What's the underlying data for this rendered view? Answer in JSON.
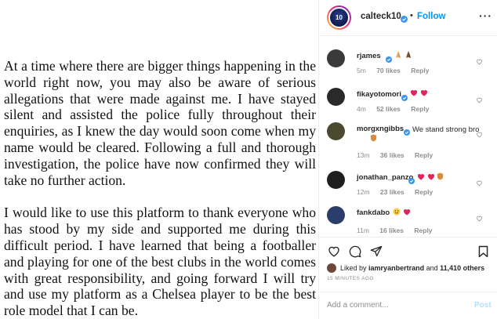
{
  "post": {
    "paragraphs": [
      "At a time where there are bigger things happening in the world right now, you may also be aware of serious allegations that were made against me. I have stayed silent and assisted the police fully throughout their enquiries, as I knew the day would soon come when my name would be cleared. Following a full and thorough investigation, the police have now confirmed they will take no further action.",
      "I would like to use this platform to thank everyone who has stood by my side and supported me during this difficult period. I have learned that being a footballer and playing for one of the best clubs in the world comes with great responsibility, and going forward I will try and use my platform as a Chelsea player to be the best role model that I can be."
    ]
  },
  "header": {
    "username": "calteck10",
    "separator": "•",
    "follow_label": "Follow",
    "more_label": "···",
    "avatar_text": "10"
  },
  "comments": [
    {
      "username": "rjames",
      "verified": true,
      "text": "",
      "emojis": [
        "folded-hands",
        "folded-hands"
      ],
      "age": "5m",
      "likes": "70 likes",
      "reply": "Reply",
      "avatar_color": "#3a3a3a"
    },
    {
      "username": "fikayotomori",
      "verified": true,
      "text": "",
      "emojis": [
        "red-heart",
        "red-heart"
      ],
      "age": "4m",
      "likes": "52 likes",
      "reply": "Reply",
      "avatar_color": "#2a2a2a"
    },
    {
      "username": "morgxngibbs",
      "verified": true,
      "text": "We stand strong bro",
      "emojis": [
        "shield"
      ],
      "age": "13m",
      "likes": "36 likes",
      "reply": "Reply",
      "avatar_color": "#4a4a30"
    },
    {
      "username": "jonathan_panzo",
      "verified": true,
      "text": "",
      "emojis": [
        "red-heart",
        "red-heart",
        "shield"
      ],
      "age": "12m",
      "likes": "23 likes",
      "reply": "Reply",
      "avatar_color": "#1f1f1f"
    },
    {
      "username": "fankdabo",
      "verified": false,
      "text": "",
      "emojis": [
        "smiling-face",
        "red-heart"
      ],
      "age": "11m",
      "likes": "16 likes",
      "reply": "Reply",
      "avatar_color": "#2b3d6a"
    }
  ],
  "likes": {
    "prefix": "Liked by",
    "user": "iamryanbertrand",
    "joiner": "and",
    "count": "11,410 others"
  },
  "timestamp": "15 minutes ago",
  "add_comment": {
    "placeholder": "Add a comment...",
    "post_label": "Post"
  },
  "colors": {
    "link_blue": "#0095f6",
    "verified_blue": "#3897f0",
    "heart_red": "#ed4956",
    "muted_text": "#8e8e8e",
    "post_disabled": "#b2dffc"
  },
  "icons": [
    "like-icon",
    "comment-icon",
    "share-icon",
    "save-icon",
    "verified-badge-icon",
    "heart-outline-icon"
  ]
}
